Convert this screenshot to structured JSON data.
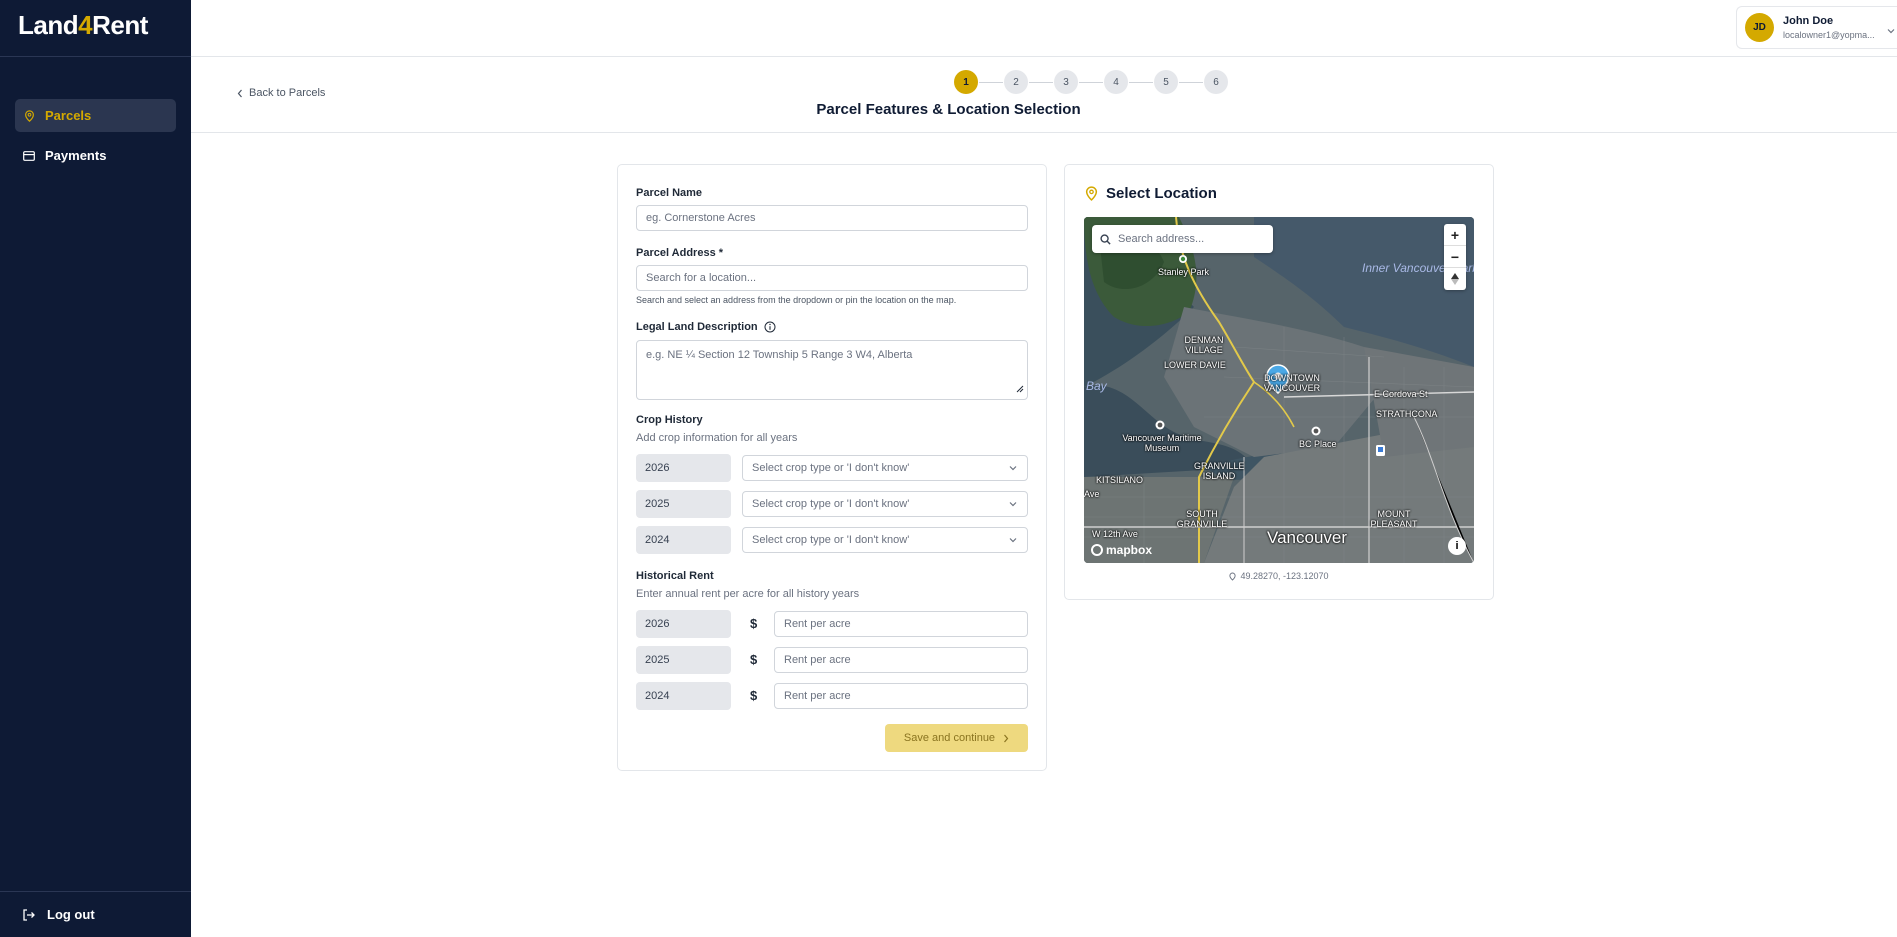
{
  "app": {
    "logo_part1": "Land",
    "logo_part2": "4",
    "logo_part3": "Rent"
  },
  "sidebar": {
    "items": [
      {
        "label": "Parcels",
        "icon": "map-pin-icon",
        "active": true
      },
      {
        "label": "Payments",
        "icon": "credit-card-icon",
        "active": false
      }
    ],
    "logout_label": "Log out"
  },
  "user": {
    "initials": "JD",
    "name": "John Doe",
    "email": "localowner1@yopma..."
  },
  "header": {
    "back_label": "Back to Parcels",
    "steps": [
      "1",
      "2",
      "3",
      "4",
      "5",
      "6"
    ],
    "active_step": 1,
    "page_title": "Parcel Features & Location Selection"
  },
  "form": {
    "parcel_name_label": "Parcel Name",
    "parcel_name_placeholder": "eg. Cornerstone Acres",
    "parcel_address_label": "Parcel Address *",
    "parcel_address_placeholder": "Search for a location...",
    "parcel_address_hint": "Search and select an address from the dropdown or pin the location on the map.",
    "legal_label": "Legal Land Description",
    "legal_placeholder": "e.g. NE ¼ Section 12 Township 5 Range 3 W4, Alberta",
    "crop_history_label": "Crop History",
    "crop_history_sub": "Add crop information for all years",
    "crop_rows": [
      {
        "year": "2026",
        "placeholder": "Select crop type or 'I don't know'"
      },
      {
        "year": "2025",
        "placeholder": "Select crop type or 'I don't know'"
      },
      {
        "year": "2024",
        "placeholder": "Select crop type or 'I don't know'"
      }
    ],
    "rent_label": "Historical Rent",
    "rent_sub": "Enter annual rent per acre for all history years",
    "currency_symbol": "$",
    "rent_rows": [
      {
        "year": "2026",
        "placeholder": "Rent per acre"
      },
      {
        "year": "2025",
        "placeholder": "Rent per acre"
      },
      {
        "year": "2024",
        "placeholder": "Rent per acre"
      }
    ],
    "save_label": "Save and continue"
  },
  "map": {
    "title": "Select Location",
    "search_placeholder": "Search address...",
    "zoom_in": "+",
    "zoom_out": "−",
    "attribution": "mapbox",
    "coordinates": "49.28270, -123.12070",
    "labels": {
      "stanley_park": "Stanley Park",
      "inner_harbour": "Inner Vancouver Harbour",
      "denman_village": "DENMAN VILLAGE",
      "lower_davie": "LOWER DAVIE",
      "downtown": "DOWNTOWN VANCOUVER",
      "cordova": "E Cordova St",
      "strathcona": "STRATHCONA",
      "bay": "Bay",
      "maritime": "Vancouver Maritime Museum",
      "bc_place": "BC Place",
      "kitsilano": "KITSILANO",
      "granville_island": "GRANVILLE ISLAND",
      "south_granville": "SOUTH GRANVILLE",
      "mount_pleasant": "MOUNT PLEASANT",
      "vancouver": "Vancouver",
      "w12th": "W 12th Ave",
      "ave": "Ave"
    }
  }
}
